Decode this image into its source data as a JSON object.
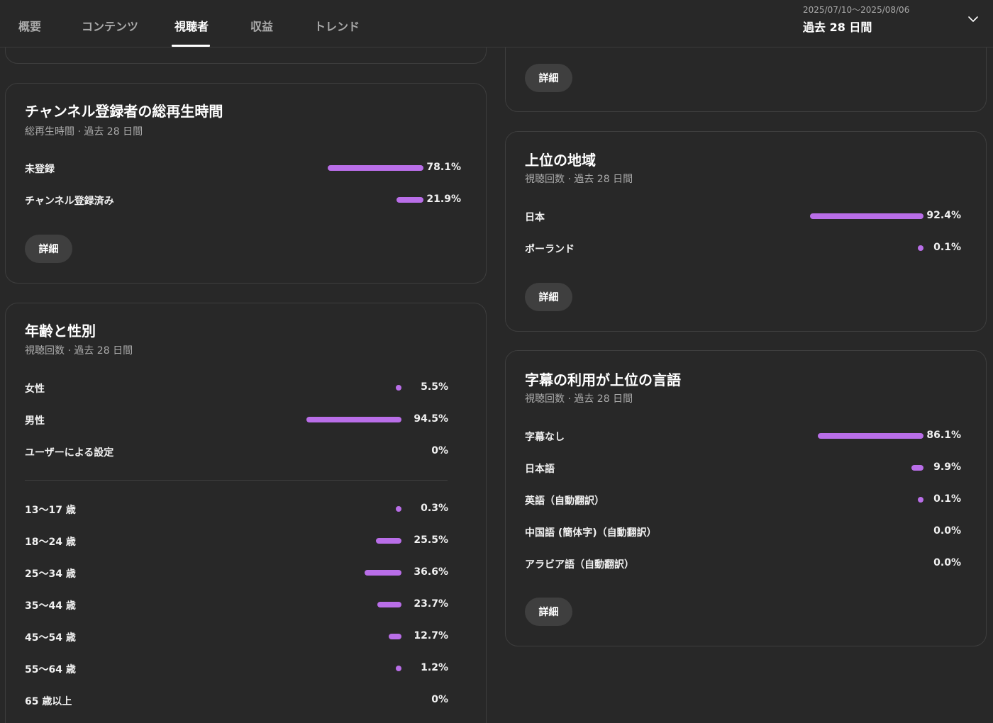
{
  "header": {
    "tabs": [
      {
        "label": "概要"
      },
      {
        "label": "コンテンツ"
      },
      {
        "label": "視聴者"
      },
      {
        "label": "収益"
      },
      {
        "label": "トレンド"
      }
    ],
    "active_tab": "視聴者",
    "date_range": "2025/07/10〜2025/08/06",
    "period": "過去 28 日間"
  },
  "accent_color": "#b96ee8",
  "detail_label": "詳細",
  "subscribers": {
    "title": "チャンネル登録者の総再生時間",
    "subtitle": "総再生時間 · 過去 28 日間",
    "rows": [
      {
        "label": "未登録",
        "value": "78.1%",
        "fraction": 0.781
      },
      {
        "label": "チャンネル登録済み",
        "value": "21.9%",
        "fraction": 0.219
      }
    ]
  },
  "age_gender": {
    "title": "年齢と性別",
    "subtitle": "視聴回数 · 過去 28 日間",
    "gender": [
      {
        "label": "女性",
        "value": "5.5%",
        "fraction": 0.055
      },
      {
        "label": "男性",
        "value": "94.5%",
        "fraction": 0.945
      },
      {
        "label": "ユーザーによる設定",
        "value": "0%",
        "fraction": 0
      }
    ],
    "ages": [
      {
        "label": "13〜17 歳",
        "value": "0.3%",
        "fraction": 0.003
      },
      {
        "label": "18〜24 歳",
        "value": "25.5%",
        "fraction": 0.255
      },
      {
        "label": "25〜34 歳",
        "value": "36.6%",
        "fraction": 0.366
      },
      {
        "label": "35〜44 歳",
        "value": "23.7%",
        "fraction": 0.237
      },
      {
        "label": "45〜54 歳",
        "value": "12.7%",
        "fraction": 0.127
      },
      {
        "label": "55〜64 歳",
        "value": "1.2%",
        "fraction": 0.012
      },
      {
        "label": "65 歳以上",
        "value": "0%",
        "fraction": 0
      }
    ]
  },
  "regions": {
    "title": "上位の地域",
    "subtitle": "視聴回数 · 過去 28 日間",
    "rows": [
      {
        "label": "日本",
        "value": "92.4%",
        "fraction": 0.924
      },
      {
        "label": "ポーランド",
        "value": "0.1%",
        "fraction": 0.001
      }
    ]
  },
  "subtitles": {
    "title": "字幕の利用が上位の言語",
    "subtitle": "視聴回数 · 過去 28 日間",
    "rows": [
      {
        "label": "字幕なし",
        "value": "86.1%",
        "fraction": 0.861
      },
      {
        "label": "日本語",
        "value": "9.9%",
        "fraction": 0.099
      },
      {
        "label": "英語（自動翻訳）",
        "value": "0.1%",
        "fraction": 0.001
      },
      {
        "label": "中国語 (簡体字)（自動翻訳）",
        "value": "0.0%",
        "fraction": 0
      },
      {
        "label": "アラビア語（自動翻訳）",
        "value": "0.0%",
        "fraction": 0
      }
    ]
  }
}
